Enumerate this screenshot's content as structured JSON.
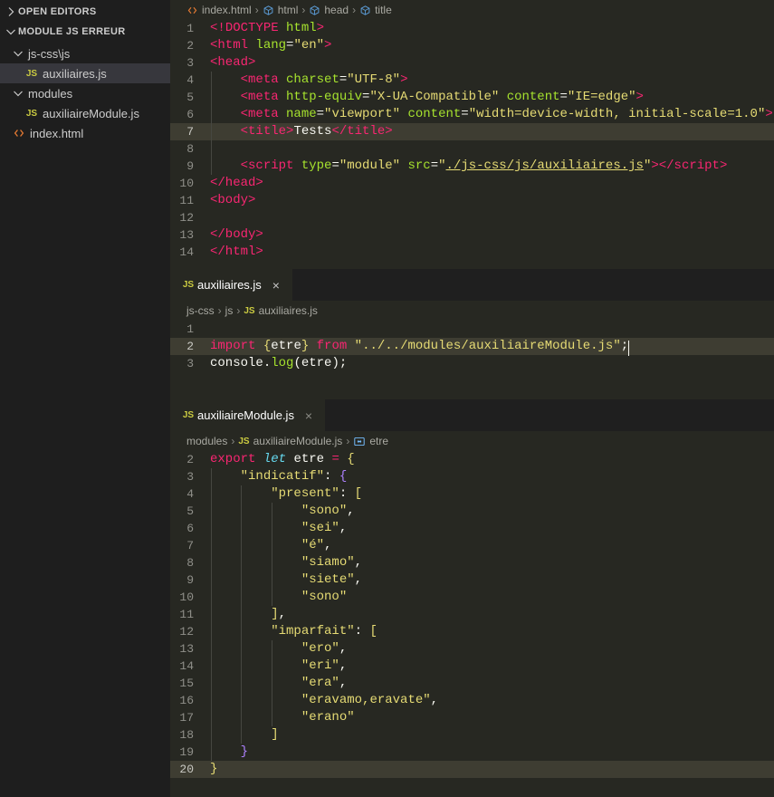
{
  "sidebar": {
    "open_editors": {
      "label": "OPEN EDITORS",
      "expanded": false
    },
    "folder": {
      "label": "MODULE JS ERREUR",
      "expanded": true
    },
    "rows": [
      {
        "label": "js-css\\js",
        "type": "folder",
        "depth": 1,
        "expanded": true,
        "selected": false
      },
      {
        "label": "auxiliaires.js",
        "type": "js",
        "depth": 2,
        "selected": true
      },
      {
        "label": "modules",
        "type": "folder",
        "depth": 1,
        "expanded": true,
        "selected": false
      },
      {
        "label": "auxiliaireModule.js",
        "type": "js",
        "depth": 2,
        "selected": false
      },
      {
        "label": "index.html",
        "type": "html",
        "depth": 1,
        "selected": false
      }
    ]
  },
  "groups": [
    {
      "tab": {
        "label": "index.html",
        "icon": "html-icon",
        "close": "×",
        "show_tab": false
      },
      "breadcrumb": [
        {
          "label": "index.html",
          "icon": "html-icon"
        },
        {
          "label": "html",
          "icon": "symbol-field-icon"
        },
        {
          "label": "head",
          "icon": "symbol-field-icon"
        },
        {
          "label": "title",
          "icon": "symbol-field-icon"
        }
      ],
      "active_line": 7,
      "lines": [
        {
          "n": 1,
          "html": "<span class=\"t-tag\">&lt;!</span><span class=\"t-tag\">DOCTYPE</span> <span class=\"t-attr\">html</span><span class=\"t-tag\">&gt;</span>"
        },
        {
          "n": 2,
          "html": "<span class=\"t-tag\">&lt;html</span> <span class=\"t-attr\">lang</span><span class=\"t-punct\">=</span><span class=\"t-str\">\"en\"</span><span class=\"t-tag\">&gt;</span>"
        },
        {
          "n": 3,
          "html": "<span class=\"t-tag\">&lt;head</span><span class=\"t-tag\">&gt;</span>"
        },
        {
          "n": 4,
          "html": "    <span class=\"t-tag\">&lt;meta</span> <span class=\"t-attr\">charset</span><span class=\"t-punct\">=</span><span class=\"t-str\">\"UTF-8\"</span><span class=\"t-tag\">&gt;</span>",
          "guides": [
            1
          ]
        },
        {
          "n": 5,
          "html": "    <span class=\"t-tag\">&lt;meta</span> <span class=\"t-attr\">http-equiv</span><span class=\"t-punct\">=</span><span class=\"t-str\">\"X-UA-Compatible\"</span> <span class=\"t-attr\">content</span><span class=\"t-punct\">=</span><span class=\"t-str\">\"IE=edge\"</span><span class=\"t-tag\">&gt;</span>",
          "guides": [
            1
          ]
        },
        {
          "n": 6,
          "html": "    <span class=\"t-tag\">&lt;meta</span> <span class=\"t-attr\">name</span><span class=\"t-punct\">=</span><span class=\"t-str\">\"viewport\"</span> <span class=\"t-attr\">content</span><span class=\"t-punct\">=</span><span class=\"t-str\">\"width=device-width, initial-scale=1.0\"</span><span class=\"t-tag\">&gt;</span>",
          "guides": [
            1
          ]
        },
        {
          "n": 7,
          "html": "    <span class=\"t-tag\">&lt;title</span><span class=\"t-tag\">&gt;</span><span class=\"t-txt\">Tests</span><span class=\"t-tag\">&lt;/title</span><span class=\"t-tag\">&gt;</span>",
          "guides": [
            1
          ]
        },
        {
          "n": 8,
          "html": "",
          "guides": [
            1
          ]
        },
        {
          "n": 9,
          "html": "    <span class=\"t-tag\">&lt;script</span> <span class=\"t-attr\">type</span><span class=\"t-punct\">=</span><span class=\"t-str\">\"module\"</span> <span class=\"t-attr\">src</span><span class=\"t-punct\">=</span><span class=\"t-str\">\"</span><span class=\"t-link\">./js-css/js/auxiliaires.js</span><span class=\"t-str\">\"</span><span class=\"t-tag\">&gt;</span><span class=\"t-tag\">&lt;/script</span><span class=\"t-tag\">&gt;</span>",
          "guides": [
            1
          ]
        },
        {
          "n": 10,
          "html": "<span class=\"t-tag\">&lt;/head</span><span class=\"t-tag\">&gt;</span>"
        },
        {
          "n": 11,
          "html": "<span class=\"t-tag\">&lt;body</span><span class=\"t-tag\">&gt;</span>"
        },
        {
          "n": 12,
          "html": ""
        },
        {
          "n": 13,
          "html": "<span class=\"t-tag\">&lt;/body</span><span class=\"t-tag\">&gt;</span>"
        },
        {
          "n": 14,
          "html": "<span class=\"t-tag\">&lt;/html</span><span class=\"t-tag\">&gt;</span>"
        }
      ]
    },
    {
      "tab": {
        "label": "auxiliaires.js",
        "icon": "js-icon",
        "close": "×",
        "show_tab": true
      },
      "breadcrumb": [
        {
          "label": "js-css",
          "icon": ""
        },
        {
          "label": "js",
          "icon": ""
        },
        {
          "label": "auxiliaires.js",
          "icon": "js-icon"
        }
      ],
      "active_line": 2,
      "lines": [
        {
          "n": 1,
          "html": ""
        },
        {
          "n": 2,
          "html": "<span class=\"t-kw\">import</span> <span class=\"t-brace-y\">{</span><span class=\"t-var\">etre</span><span class=\"t-brace-y\">}</span> <span class=\"t-kw\">from</span> <span class=\"t-str\">\"../../modules/auxiliaireModule.js\"</span><span class=\"t-punct\">;</span><span class=\"cursor\"></span>"
        },
        {
          "n": 3,
          "html": "<span class=\"t-var\">console</span><span class=\"t-punct\">.</span><span class=\"t-fn\">log</span><span class=\"t-punct\">(</span><span class=\"t-var\">etre</span><span class=\"t-punct\">)</span><span class=\"t-punct\">;</span>"
        }
      ]
    },
    {
      "tab": {
        "label": "auxiliaireModule.js",
        "icon": "js-icon",
        "close": "×",
        "show_tab": true
      },
      "breadcrumb": [
        {
          "label": "modules",
          "icon": ""
        },
        {
          "label": "auxiliaireModule.js",
          "icon": "js-icon"
        },
        {
          "label": "etre",
          "icon": "symbol-variable-icon"
        }
      ],
      "active_line": 20,
      "lines": [
        {
          "n": 2,
          "html": "<span class=\"t-kw\">export</span> <span class=\"t-storage\">let</span> <span class=\"t-var\">etre</span> <span class=\"t-op\">=</span> <span class=\"t-brace-y\">{</span>"
        },
        {
          "n": 3,
          "html": "    <span class=\"t-str\">\"indicatif\"</span><span class=\"t-punct\">:</span> <span class=\"t-brace-m\">{</span>",
          "guides": [
            1
          ]
        },
        {
          "n": 4,
          "html": "        <span class=\"t-str\">\"present\"</span><span class=\"t-punct\">:</span> <span class=\"t-brace-y\">[</span>",
          "guides": [
            1,
            2
          ]
        },
        {
          "n": 5,
          "html": "            <span class=\"t-str\">\"sono\"</span><span class=\"t-comma\">,</span>",
          "guides": [
            1,
            2,
            3
          ]
        },
        {
          "n": 6,
          "html": "            <span class=\"t-str\">\"sei\"</span><span class=\"t-comma\">,</span>",
          "guides": [
            1,
            2,
            3
          ]
        },
        {
          "n": 7,
          "html": "            <span class=\"t-str\">\"é\"</span><span class=\"t-comma\">,</span>",
          "guides": [
            1,
            2,
            3
          ]
        },
        {
          "n": 8,
          "html": "            <span class=\"t-str\">\"siamo\"</span><span class=\"t-comma\">,</span>",
          "guides": [
            1,
            2,
            3
          ]
        },
        {
          "n": 9,
          "html": "            <span class=\"t-str\">\"siete\"</span><span class=\"t-comma\">,</span>",
          "guides": [
            1,
            2,
            3
          ]
        },
        {
          "n": 10,
          "html": "            <span class=\"t-str\">\"sono\"</span>",
          "guides": [
            1,
            2,
            3
          ]
        },
        {
          "n": 11,
          "html": "        <span class=\"t-brace-y\">]</span><span class=\"t-comma\">,</span>",
          "guides": [
            1,
            2
          ]
        },
        {
          "n": 12,
          "html": "        <span class=\"t-str\">\"imparfait\"</span><span class=\"t-punct\">:</span> <span class=\"t-brace-y\">[</span>",
          "guides": [
            1,
            2
          ]
        },
        {
          "n": 13,
          "html": "            <span class=\"t-str\">\"ero\"</span><span class=\"t-comma\">,</span>",
          "guides": [
            1,
            2,
            3
          ]
        },
        {
          "n": 14,
          "html": "            <span class=\"t-str\">\"eri\"</span><span class=\"t-comma\">,</span>",
          "guides": [
            1,
            2,
            3
          ]
        },
        {
          "n": 15,
          "html": "            <span class=\"t-str\">\"era\"</span><span class=\"t-comma\">,</span>",
          "guides": [
            1,
            2,
            3
          ]
        },
        {
          "n": 16,
          "html": "            <span class=\"t-str\">\"eravamo,eravate\"</span><span class=\"t-comma\">,</span>",
          "guides": [
            1,
            2,
            3
          ]
        },
        {
          "n": 17,
          "html": "            <span class=\"t-str\">\"erano\"</span>",
          "guides": [
            1,
            2,
            3
          ]
        },
        {
          "n": 18,
          "html": "        <span class=\"t-brace-y\">]</span>",
          "guides": [
            1,
            2
          ]
        },
        {
          "n": 19,
          "html": "    <span class=\"t-brace-m\">}</span>",
          "guides": [
            1
          ]
        },
        {
          "n": 20,
          "html": "<span class=\"t-brace-y\">}</span>"
        }
      ]
    }
  ],
  "colors": {
    "editor_bg": "#272822",
    "sidebar_bg": "#1e1e1e",
    "tabbar_bg": "#1f1f1f",
    "active_line": "#3e3d32",
    "selection": "#37373d",
    "js_icon": "#cbcb41",
    "html_icon": "#e37933",
    "tag": "#f92672",
    "string": "#e6db74",
    "attr": "#a6e22e",
    "storage": "#66d9ef",
    "brace_purple": "#ae81ff"
  }
}
